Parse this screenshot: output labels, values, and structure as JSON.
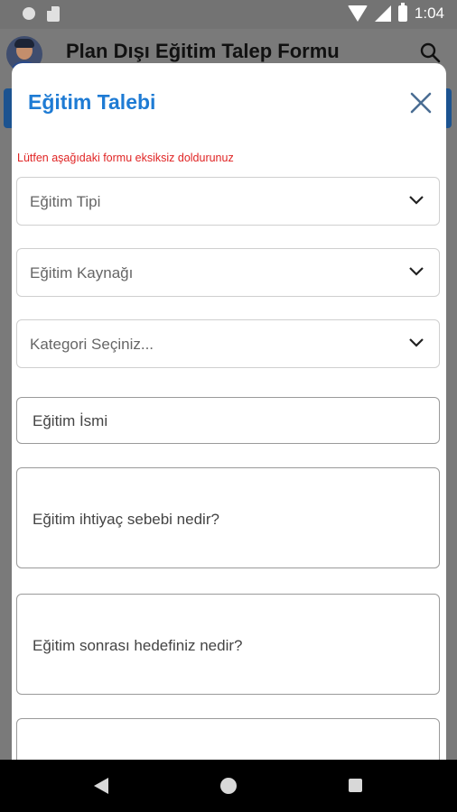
{
  "status_bar": {
    "time": "1:04"
  },
  "app_bar": {
    "title": "Plan Dışı Eğitim Talep Formu",
    "search_icon": "search-icon"
  },
  "dialog": {
    "title": "Eğitim Talebi",
    "close_icon": "close-icon",
    "hint": "Lütfen aşağıdaki formu eksiksiz doldurunuz",
    "fields": {
      "education_type": {
        "placeholder": "Eğitim Tipi"
      },
      "education_source": {
        "placeholder": "Eğitim Kaynağı"
      },
      "category": {
        "placeholder": "Kategori Seçiniz..."
      },
      "education_name": {
        "placeholder": "Eğitim İsmi"
      },
      "need_reason": {
        "placeholder": "Eğitim ihtiyaç sebebi nedir?"
      },
      "post_goal": {
        "placeholder": "Eğitim sonrası hedefiniz nedir?"
      }
    }
  },
  "colors": {
    "accent": "#1e7bd4",
    "hint": "#e02424",
    "overlay": "#7a7a7a"
  }
}
